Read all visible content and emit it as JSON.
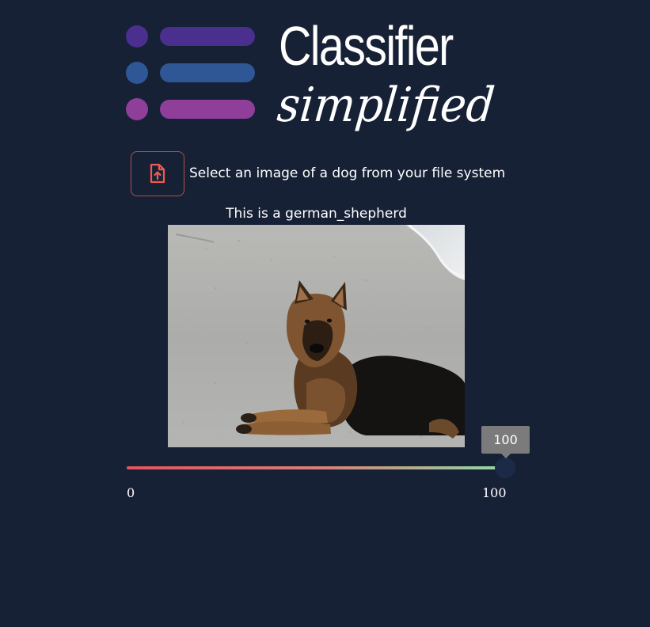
{
  "logo": {
    "title": "Classifier",
    "subtitle": "simplified",
    "colors": [
      "#4a2f8f",
      "#2f5796",
      "#8f3f9a"
    ]
  },
  "uploader": {
    "icon": "file-upload-icon",
    "icon_color": "#ef5b4c",
    "label": "Select an image of a dog from your file system"
  },
  "result": {
    "caption": "This is a german_shepherd",
    "image_subject": "german shepherd dog lying on beach sand"
  },
  "slider": {
    "min_label": "0",
    "max_label": "100",
    "value": 100,
    "value_label": "100",
    "min": 0,
    "max": 100
  }
}
